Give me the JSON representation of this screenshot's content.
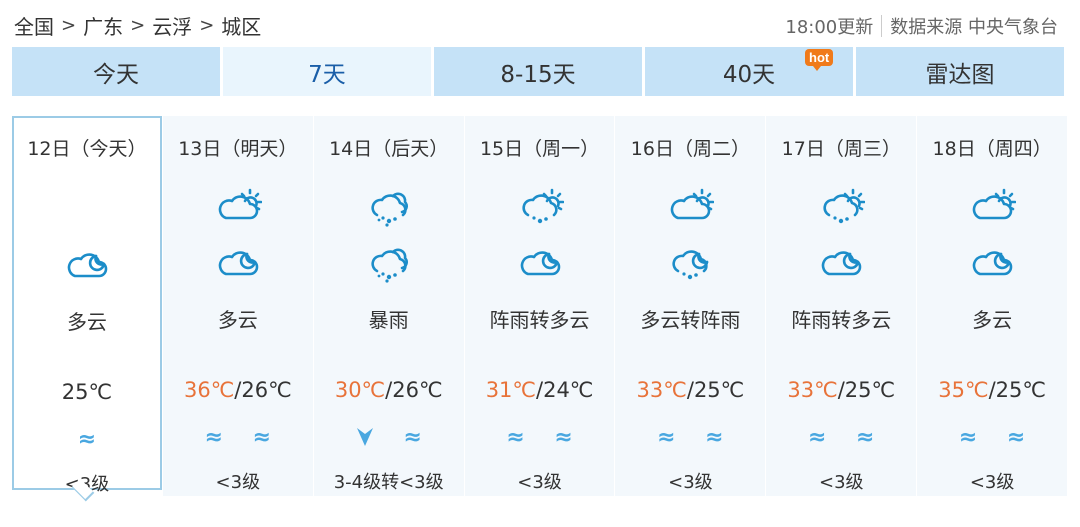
{
  "breadcrumb": {
    "items": [
      "全国",
      "广东",
      "云浮",
      "城区"
    ],
    "separator": ">"
  },
  "source": {
    "update_time": "18:00更新",
    "label": "数据来源 中央气象台"
  },
  "tabs": [
    {
      "label": "今天",
      "active": false
    },
    {
      "label": "7天",
      "active": true
    },
    {
      "label": "8-15天",
      "active": false
    },
    {
      "label": "40天",
      "active": false,
      "badge": "hot"
    },
    {
      "label": "雷达图",
      "active": false
    }
  ],
  "colors": {
    "tab_bg": "#c5e2f7",
    "tab_active_bg": "#e9f5fd",
    "high_temp": "#e8733a",
    "icon": "#1c8dc9",
    "wind_icon": "#49a7e0",
    "hot_badge": "#f07a1a"
  },
  "days": [
    {
      "date": "12日（今天）",
      "day_icon": "",
      "night_icon": "cloudy-night-icon",
      "weather": "多云",
      "high": "",
      "low": "25℃",
      "wind_icons": [
        "wind-wave-icon"
      ],
      "wind": "<3级",
      "today": true
    },
    {
      "date": "13日（明天）",
      "day_icon": "cloudy-day-icon",
      "night_icon": "cloudy-night-icon",
      "weather": "多云",
      "high": "36℃",
      "low": "26℃",
      "wind_icons": [
        "wind-wave-icon",
        "wind-wave-icon"
      ],
      "wind": "<3级"
    },
    {
      "date": "14日（后天）",
      "day_icon": "rainstorm-icon",
      "night_icon": "rainstorm-icon",
      "weather": "暴雨",
      "high": "30℃",
      "low": "26℃",
      "wind_icons": [
        "wind-arrow-icon",
        "wind-wave-icon"
      ],
      "wind": "3-4级转<3级"
    },
    {
      "date": "15日（周一）",
      "day_icon": "shower-day-icon",
      "night_icon": "cloudy-night-icon",
      "weather": "阵雨转多云",
      "high": "31℃",
      "low": "24℃",
      "wind_icons": [
        "wind-wave-icon",
        "wind-wave-icon"
      ],
      "wind": "<3级"
    },
    {
      "date": "16日（周二）",
      "day_icon": "cloudy-day-icon",
      "night_icon": "shower-night-icon",
      "weather": "多云转阵雨",
      "high": "33℃",
      "low": "25℃",
      "wind_icons": [
        "wind-wave-icon",
        "wind-wave-icon"
      ],
      "wind": "<3级"
    },
    {
      "date": "17日（周三）",
      "day_icon": "shower-day-icon",
      "night_icon": "cloudy-night-icon",
      "weather": "阵雨转多云",
      "high": "33℃",
      "low": "25℃",
      "wind_icons": [
        "wind-wave-icon",
        "wind-wave-icon"
      ],
      "wind": "<3级"
    },
    {
      "date": "18日（周四）",
      "day_icon": "cloudy-day-icon",
      "night_icon": "cloudy-night-icon",
      "weather": "多云",
      "high": "35℃",
      "low": "25℃",
      "wind_icons": [
        "wind-wave-icon",
        "wind-wave-icon"
      ],
      "wind": "<3级"
    }
  ],
  "glyphs": {
    "wind-wave-icon": "≈",
    "wind-arrow-icon": "➤",
    "temp_sep": "/"
  }
}
